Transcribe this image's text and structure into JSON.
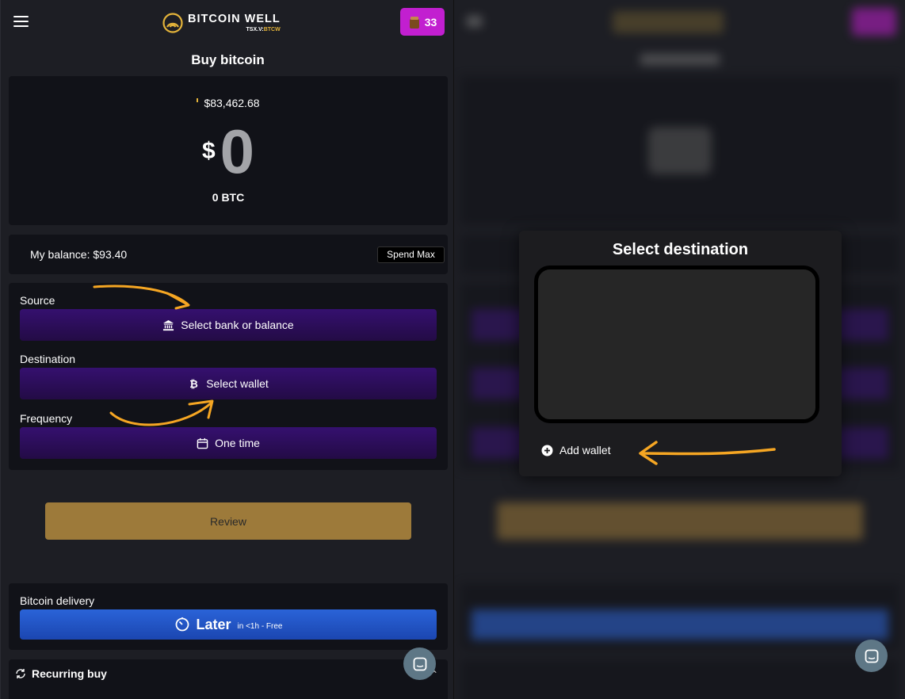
{
  "header": {
    "logo_name": "BITCOIN WELL",
    "ticker_prefix": "TSX.V:",
    "ticker_symbol": "BTCW",
    "badge_count": "33"
  },
  "page_title": "Buy bitcoin",
  "amount": {
    "btc_price": "$83,462.68",
    "currency_symbol": "$",
    "value": "0",
    "btc_value": "0 BTC"
  },
  "balance": {
    "label": "My balance: $93.40",
    "spend_max": "Spend Max"
  },
  "form": {
    "source_label": "Source",
    "source_button": "Select bank or balance",
    "destination_label": "Destination",
    "destination_button": "Select wallet",
    "frequency_label": "Frequency",
    "frequency_button": "One time"
  },
  "review_button": "Review",
  "delivery": {
    "label": "Bitcoin delivery",
    "button_main": "Later",
    "button_sub": "in <1h - Free"
  },
  "recurring": {
    "label": "Recurring buy"
  },
  "modal": {
    "title": "Select destination",
    "add_wallet": "Add wallet"
  },
  "colors": {
    "accent_purple": "#35106f",
    "accent_gold": "#9d7a3a",
    "accent_blue": "#2a63d8",
    "badge_magenta": "#c21fd0",
    "annotation_orange": "#f5a623"
  }
}
